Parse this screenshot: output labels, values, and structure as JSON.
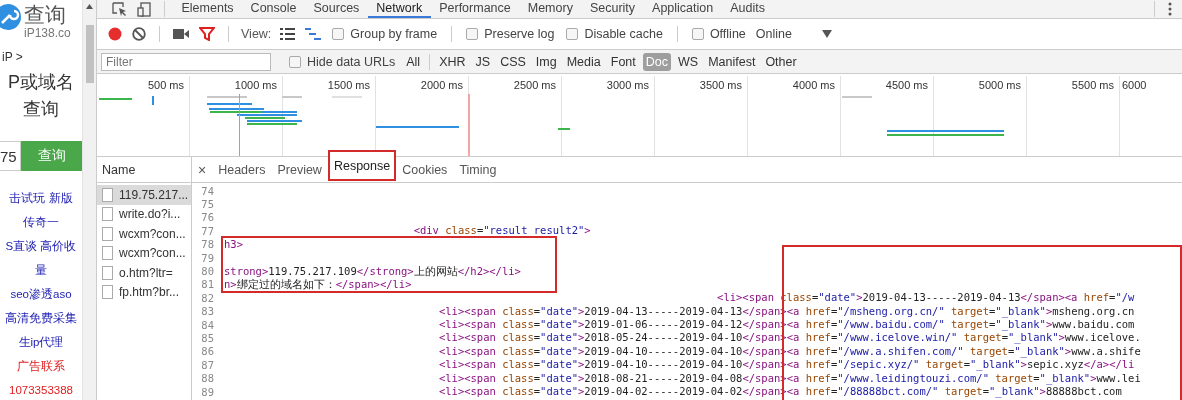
{
  "page": {
    "logo_title": "查询",
    "logo_subtitle": "iP138.co",
    "breadcrumb": "iP >",
    "heading": [
      "P或域名",
      "查询"
    ],
    "query_input": {
      "value": "75"
    },
    "query_button": "查询",
    "links": [
      {
        "text": "击试玩 新版",
        "kind": "link"
      },
      {
        "text": "传奇一",
        "kind": "link"
      },
      {
        "text": "S直谈 高价收",
        "kind": "link"
      },
      {
        "text": "量",
        "kind": "link"
      },
      {
        "text": "seo渗透aso",
        "kind": "link"
      },
      {
        "text": "高清免费采集",
        "kind": "link"
      },
      {
        "text": "生ip代理",
        "kind": "link"
      },
      {
        "text": "广告联系",
        "kind": "contact"
      },
      {
        "text": "1073353388",
        "kind": "contact"
      }
    ]
  },
  "tabs": [
    {
      "label": "Elements",
      "selected": false
    },
    {
      "label": "Console",
      "selected": false
    },
    {
      "label": "Sources",
      "selected": false
    },
    {
      "label": "Network",
      "selected": true
    },
    {
      "label": "Performance",
      "selected": false
    },
    {
      "label": "Memory",
      "selected": false
    },
    {
      "label": "Security",
      "selected": false
    },
    {
      "label": "Application",
      "selected": false
    },
    {
      "label": "Audits",
      "selected": false
    }
  ],
  "toolbar": {
    "recording": true,
    "filter_active": true,
    "view_label": "View:",
    "waterfall_view": true,
    "options": [
      {
        "label": "Group by frame",
        "checked": false
      },
      {
        "label": "Preserve log",
        "checked": false
      },
      {
        "label": "Disable cache",
        "checked": false
      },
      {
        "label": "Offline",
        "checked": false
      }
    ],
    "throttling": "Online"
  },
  "filter_bar": {
    "placeholder": "Filter",
    "hide_data_urls": {
      "label": "Hide data URLs",
      "checked": false
    },
    "types": [
      {
        "label": "All",
        "selected": false
      },
      {
        "label": "XHR",
        "selected": false
      },
      {
        "label": "JS",
        "selected": false
      },
      {
        "label": "CSS",
        "selected": false
      },
      {
        "label": "Img",
        "selected": false
      },
      {
        "label": "Media",
        "selected": false
      },
      {
        "label": "Font",
        "selected": false
      },
      {
        "label": "Doc",
        "selected": true
      },
      {
        "label": "WS",
        "selected": false
      },
      {
        "label": "Manifest",
        "selected": false
      },
      {
        "label": "Other",
        "selected": false
      }
    ]
  },
  "timeline": {
    "ticks": [
      "500 ms",
      "1000 ms",
      "1500 ms",
      "2000 ms",
      "2500 ms",
      "3000 ms",
      "3500 ms",
      "4000 ms",
      "4500 ms",
      "5000 ms",
      "5500 ms",
      "6000"
    ]
  },
  "requests": {
    "header": "Name",
    "items": [
      {
        "name": "119.75.217...",
        "selected": true
      },
      {
        "name": "write.do?i...",
        "selected": false
      },
      {
        "name": "wcxm?con...",
        "selected": false
      },
      {
        "name": "wcxm?con...",
        "selected": false
      },
      {
        "name": "o.htm?ltr=",
        "selected": false
      },
      {
        "name": "fp.htm?br...",
        "selected": false
      }
    ]
  },
  "detail": {
    "close": "×",
    "tabs": [
      {
        "label": "Headers",
        "selected": false,
        "outlined": false
      },
      {
        "label": "Preview",
        "selected": false,
        "outlined": false
      },
      {
        "label": "Response",
        "selected": true,
        "outlined": true
      },
      {
        "label": "Cookies",
        "selected": false,
        "outlined": false
      },
      {
        "label": "Timing",
        "selected": false,
        "outlined": false
      }
    ],
    "lines": [
      {
        "number": "74"
      },
      {
        "number": "75"
      },
      {
        "number": "76"
      },
      {
        "number": "77",
        "tokens": [
          {
            "kind": "tag",
            "text": "                              <div "
          },
          {
            "kind": "attr",
            "text": "class"
          },
          {
            "kind": "text",
            "text": "="
          },
          {
            "kind": "value",
            "text": "\"result result2\""
          },
          {
            "kind": "tag",
            "text": ">"
          }
        ]
      },
      {
        "number": "78",
        "tokens": [
          {
            "kind": "tag",
            "text": "h3>"
          }
        ]
      },
      {
        "number": "79"
      },
      {
        "number": "80",
        "tokens": [
          {
            "kind": "tag",
            "text": "strong>"
          },
          {
            "kind": "text",
            "text": "119.75.217.109"
          },
          {
            "kind": "tag",
            "text": "</strong>"
          },
          {
            "kind": "text",
            "text": "上的网站"
          },
          {
            "kind": "tag",
            "text": "</h2></li>"
          }
        ]
      },
      {
        "number": "81",
        "tokens": [
          {
            "kind": "tag",
            "text": "n>"
          },
          {
            "kind": "text",
            "text": "绑定过的域名如下："
          },
          {
            "kind": "tag",
            "text": "</span></li>"
          }
        ]
      },
      {
        "number": "82",
        "tokens": [
          {
            "kind": "tag",
            "text": "                                                                              <li><span "
          },
          {
            "kind": "attr",
            "text": "class"
          },
          {
            "kind": "text",
            "text": "="
          },
          {
            "kind": "value",
            "text": "\"date\""
          },
          {
            "kind": "tag",
            "text": ">"
          },
          {
            "kind": "text",
            "text": "2019-04-13-----2019-04-13"
          },
          {
            "kind": "tag",
            "text": "</span><a "
          },
          {
            "kind": "attr",
            "text": "href"
          },
          {
            "kind": "text",
            "text": "="
          },
          {
            "kind": "value",
            "text": "\"/w"
          }
        ]
      },
      {
        "number": "83",
        "tokens": [
          {
            "kind": "tag",
            "text": "                                  <li><span "
          },
          {
            "kind": "attr",
            "text": "class"
          },
          {
            "kind": "text",
            "text": "="
          },
          {
            "kind": "value",
            "text": "\"date\""
          },
          {
            "kind": "tag",
            "text": ">"
          },
          {
            "kind": "text",
            "text": "2019-04-13-----2019-04-13"
          },
          {
            "kind": "tag",
            "text": "</span><a "
          },
          {
            "kind": "attr",
            "text": "href"
          },
          {
            "kind": "text",
            "text": "="
          },
          {
            "kind": "value",
            "text": "\"/msheng.org.cn/\" "
          },
          {
            "kind": "attr",
            "text": "target"
          },
          {
            "kind": "text",
            "text": "="
          },
          {
            "kind": "value",
            "text": "\"_blank\""
          },
          {
            "kind": "tag",
            "text": ">"
          },
          {
            "kind": "text",
            "text": "msheng.org.cn"
          }
        ]
      },
      {
        "number": "84",
        "tokens": [
          {
            "kind": "tag",
            "text": "                                  <li><span "
          },
          {
            "kind": "attr",
            "text": "class"
          },
          {
            "kind": "text",
            "text": "="
          },
          {
            "kind": "value",
            "text": "\"date\""
          },
          {
            "kind": "tag",
            "text": ">"
          },
          {
            "kind": "text",
            "text": "2019-01-06-----2019-04-12"
          },
          {
            "kind": "tag",
            "text": "</span><a "
          },
          {
            "kind": "attr",
            "text": "href"
          },
          {
            "kind": "text",
            "text": "="
          },
          {
            "kind": "value",
            "text": "\"/www.baidu.com/\" "
          },
          {
            "kind": "attr",
            "text": "target"
          },
          {
            "kind": "text",
            "text": "="
          },
          {
            "kind": "value",
            "text": "\"_blank\""
          },
          {
            "kind": "tag",
            "text": ">"
          },
          {
            "kind": "text",
            "text": "www.baidu.com"
          }
        ]
      },
      {
        "number": "85",
        "tokens": [
          {
            "kind": "tag",
            "text": "                                  <li><span "
          },
          {
            "kind": "attr",
            "text": "class"
          },
          {
            "kind": "text",
            "text": "="
          },
          {
            "kind": "value",
            "text": "\"date\""
          },
          {
            "kind": "tag",
            "text": ">"
          },
          {
            "kind": "text",
            "text": "2018-05-24-----2019-04-10"
          },
          {
            "kind": "tag",
            "text": "</span><a "
          },
          {
            "kind": "attr",
            "text": "href"
          },
          {
            "kind": "text",
            "text": "="
          },
          {
            "kind": "value",
            "text": "\"/www.icelove.win/\" "
          },
          {
            "kind": "attr",
            "text": "target"
          },
          {
            "kind": "text",
            "text": "="
          },
          {
            "kind": "value",
            "text": "\"_blank\""
          },
          {
            "kind": "tag",
            "text": ">"
          },
          {
            "kind": "text",
            "text": "www.icelove."
          }
        ]
      },
      {
        "number": "86",
        "tokens": [
          {
            "kind": "tag",
            "text": "                                  <li><span "
          },
          {
            "kind": "attr",
            "text": "class"
          },
          {
            "kind": "text",
            "text": "="
          },
          {
            "kind": "value",
            "text": "\"date\""
          },
          {
            "kind": "tag",
            "text": ">"
          },
          {
            "kind": "text",
            "text": "2019-04-10-----2019-04-10"
          },
          {
            "kind": "tag",
            "text": "</span><a "
          },
          {
            "kind": "attr",
            "text": "href"
          },
          {
            "kind": "text",
            "text": "="
          },
          {
            "kind": "value",
            "text": "\"/www.a.shifen.com/\" "
          },
          {
            "kind": "attr",
            "text": "target"
          },
          {
            "kind": "text",
            "text": "="
          },
          {
            "kind": "value",
            "text": "\"_blank\""
          },
          {
            "kind": "tag",
            "text": ">"
          },
          {
            "kind": "text",
            "text": "www.a.shife"
          }
        ]
      },
      {
        "number": "87",
        "tokens": [
          {
            "kind": "tag",
            "text": "                                  <li><span "
          },
          {
            "kind": "attr",
            "text": "class"
          },
          {
            "kind": "text",
            "text": "="
          },
          {
            "kind": "value",
            "text": "\"date\""
          },
          {
            "kind": "tag",
            "text": ">"
          },
          {
            "kind": "text",
            "text": "2019-04-10-----2019-04-10"
          },
          {
            "kind": "tag",
            "text": "</span><a "
          },
          {
            "kind": "attr",
            "text": "href"
          },
          {
            "kind": "text",
            "text": "="
          },
          {
            "kind": "value",
            "text": "\"/sepic.xyz/\" "
          },
          {
            "kind": "attr",
            "text": "target"
          },
          {
            "kind": "text",
            "text": "="
          },
          {
            "kind": "value",
            "text": "\"_blank\""
          },
          {
            "kind": "tag",
            "text": ">"
          },
          {
            "kind": "text",
            "text": "sepic.xyz"
          },
          {
            "kind": "tag",
            "text": "</a></li"
          }
        ]
      },
      {
        "number": "88",
        "tokens": [
          {
            "kind": "tag",
            "text": "                                  <li><span "
          },
          {
            "kind": "attr",
            "text": "class"
          },
          {
            "kind": "text",
            "text": "="
          },
          {
            "kind": "value",
            "text": "\"date\""
          },
          {
            "kind": "tag",
            "text": ">"
          },
          {
            "kind": "text",
            "text": "2018-08-21-----2019-04-08"
          },
          {
            "kind": "tag",
            "text": "</span><a "
          },
          {
            "kind": "attr",
            "text": "href"
          },
          {
            "kind": "text",
            "text": "="
          },
          {
            "kind": "value",
            "text": "\"/www.leidingtouzi.com/\" "
          },
          {
            "kind": "attr",
            "text": "target"
          },
          {
            "kind": "text",
            "text": "="
          },
          {
            "kind": "value",
            "text": "\"_blank\""
          },
          {
            "kind": "tag",
            "text": ">"
          },
          {
            "kind": "text",
            "text": "www.lei"
          }
        ]
      },
      {
        "number": "89",
        "tokens": [
          {
            "kind": "tag",
            "text": "                                  <li><span "
          },
          {
            "kind": "attr",
            "text": "class"
          },
          {
            "kind": "text",
            "text": "="
          },
          {
            "kind": "value",
            "text": "\"date\""
          },
          {
            "kind": "tag",
            "text": ">"
          },
          {
            "kind": "text",
            "text": "2019-04-02-----2019-04-02"
          },
          {
            "kind": "tag",
            "text": "</span><a "
          },
          {
            "kind": "attr",
            "text": "href"
          },
          {
            "kind": "text",
            "text": "="
          },
          {
            "kind": "value",
            "text": "\"/88888bct.com/\" "
          },
          {
            "kind": "attr",
            "text": "target"
          },
          {
            "kind": "text",
            "text": "="
          },
          {
            "kind": "value",
            "text": "\"_blank\""
          },
          {
            "kind": "tag",
            "text": ">"
          },
          {
            "kind": "text",
            "text": "88888bct.com"
          }
        ]
      }
    ]
  }
}
